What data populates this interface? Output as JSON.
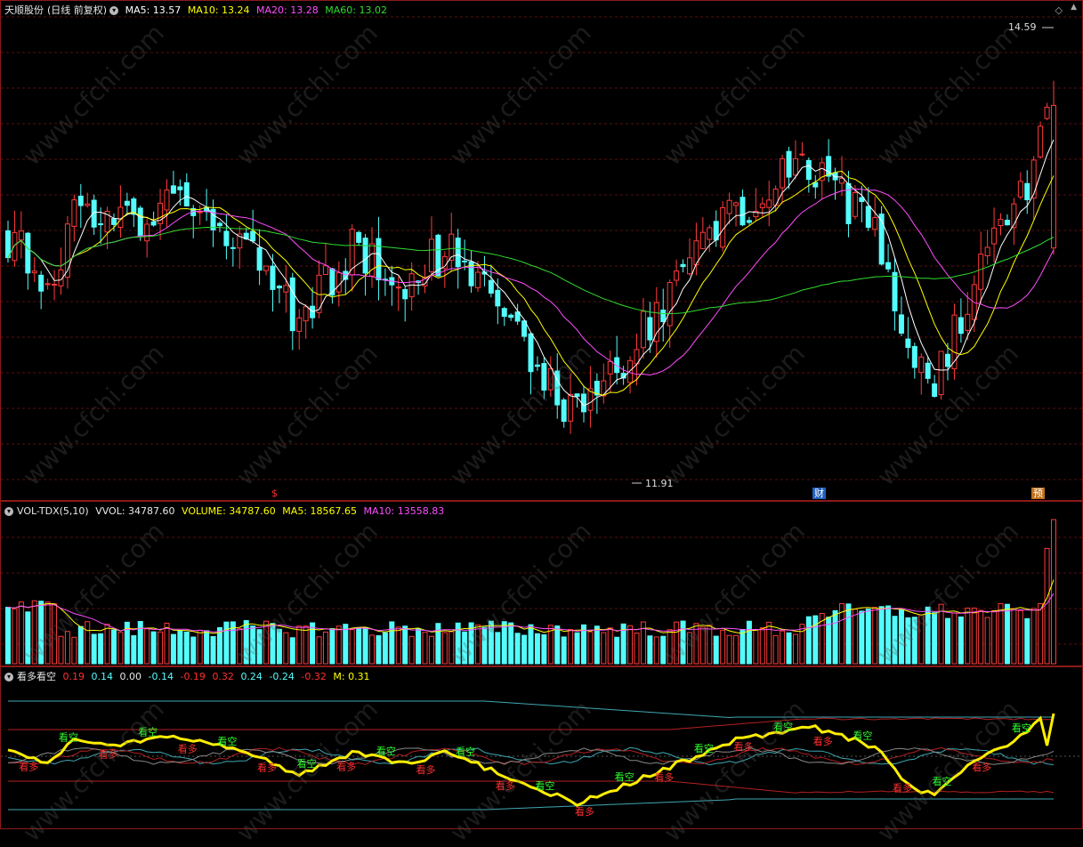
{
  "price_header": {
    "title": "天顺股份",
    "period": "(日线 前复权)",
    "ma5": "MA5: 13.57",
    "ma10": "MA10: 13.24",
    "ma20": "MA20: 13.28",
    "ma60": "MA60: 13.02"
  },
  "volume_header": {
    "name": "VOL-TDX(5,10)",
    "vvol": "VVOL: 34787.60",
    "volume": "VOLUME: 34787.60",
    "ma5": "MA5: 18567.65",
    "ma10": "MA10: 13558.83"
  },
  "indicator_header": {
    "name": "看多看空",
    "values": [
      "0.19",
      "0.14",
      "0.00",
      "-0.14",
      "-0.19",
      "0.32",
      "0.24",
      "-0.24",
      "-0.32"
    ],
    "m": "M: 0.31"
  },
  "annotations": {
    "high": "14.59",
    "low": "11.91",
    "marker_s": "$",
    "marker_cai": "财",
    "marker_yu": "预"
  },
  "watermark": "www.cfchi.com",
  "colors": {
    "up": "#ff3b3b",
    "down": "#54fcfc",
    "ma5": "#ffffff",
    "ma10": "#ffff00",
    "ma20": "#ff4dff",
    "ma60": "#2fdc2f",
    "bull_text": "#ff3030",
    "bear_text": "#30ff30",
    "signal": "#ffee00"
  },
  "chart_data": {
    "type": "candlestick",
    "title": "天顺股份 (日线 前复权)",
    "ylim": [
      11.5,
      15.0
    ],
    "high_label": 14.59,
    "low_label": 11.91,
    "series": [
      {
        "name": "MA5",
        "last": 13.57
      },
      {
        "name": "MA10",
        "last": 13.24
      },
      {
        "name": "MA20",
        "last": 13.28
      },
      {
        "name": "MA60",
        "last": 13.02
      }
    ],
    "volume": {
      "vvol": 34787.6,
      "last": 34787.6,
      "ma5": 18567.65,
      "ma10": 13558.83
    },
    "indicator": {
      "name": "看多看空",
      "values": [
        0.19,
        0.14,
        0.0,
        -0.14,
        -0.19,
        0.32,
        0.24,
        -0.24,
        -0.32
      ],
      "m": 0.31,
      "labels": {
        "bull": "看多",
        "bear": "看空"
      }
    }
  }
}
